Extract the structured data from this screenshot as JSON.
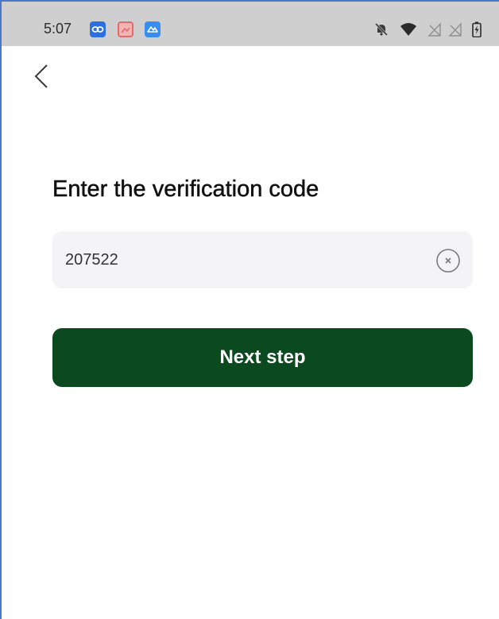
{
  "status_bar": {
    "time": "5:07",
    "notification_icons": [
      "link-app-icon",
      "gallery-app-icon",
      "cloud-app-icon"
    ],
    "system_icons": [
      "silent-bell-icon",
      "wifi-icon",
      "no-signal-icon",
      "no-signal-icon",
      "battery-charging-icon"
    ]
  },
  "header": {
    "back_icon": "chevron-left-icon"
  },
  "main": {
    "title": "Enter the verification code",
    "code_field": {
      "value": "207522",
      "clear_icon": "clear-circle-icon"
    },
    "next_button_label": "Next step"
  },
  "colors": {
    "status_bar_bg": "#cfcfcf",
    "primary_button": "#0b4a1f",
    "input_bg": "#f4f3f5",
    "frame_border": "#4a78c8"
  }
}
